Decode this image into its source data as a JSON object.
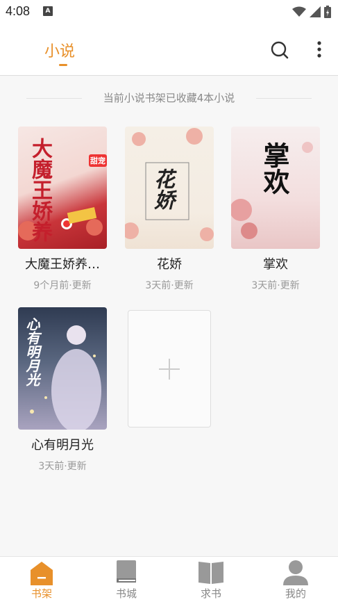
{
  "status_bar": {
    "time": "4:08",
    "notification_icon_letter": "A"
  },
  "header": {
    "tab_label": "小说"
  },
  "shelf": {
    "summary": "当前小说书架已收藏4本小说"
  },
  "books": [
    {
      "title": "大魔王娇养…",
      "update": "9个月前·更新",
      "cover_text": "大魔王娇养",
      "cover_badge": "甜宠"
    },
    {
      "title": "花娇",
      "update": "3天前·更新",
      "cover_text": "花娇"
    },
    {
      "title": "掌欢",
      "update": "3天前·更新",
      "cover_text": "掌欢"
    },
    {
      "title": "心有明月光",
      "update": "3天前·更新",
      "cover_text": "心有明月光"
    }
  ],
  "nav": [
    {
      "label": "书架",
      "icon": "bookshelf-icon",
      "active": true
    },
    {
      "label": "书城",
      "icon": "book-icon",
      "active": false
    },
    {
      "label": "求书",
      "icon": "open-book-icon",
      "active": false
    },
    {
      "label": "我的",
      "icon": "user-icon",
      "active": false
    }
  ],
  "colors": {
    "accent": "#e8902a",
    "text_secondary": "#999999"
  }
}
